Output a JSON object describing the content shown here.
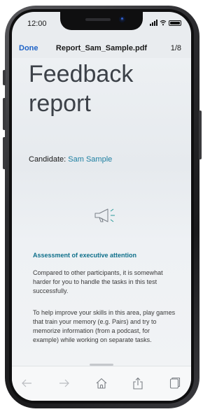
{
  "status_bar": {
    "time": "12:00"
  },
  "nav": {
    "done_label": "Done",
    "title": "Report_Sam_Sample.pdf",
    "page_indicator": "1/8"
  },
  "document": {
    "heading_line1": "Feedback",
    "heading_line2": "report",
    "candidate_label": "Candidate:",
    "candidate_name": "Sam Sample",
    "section_title": "Assessment of executive attention",
    "paragraph_1": "Compared to other participants, it is somewhat harder for you to handle the tasks in this test successfully.",
    "paragraph_2": "To help improve your skills in this area, play games that train your memory (e.g. Pairs) and try to memorize information (from a podcast, for example) while working on separate tasks."
  },
  "toolbar": {
    "icons": [
      "back-arrow-icon",
      "forward-arrow-icon",
      "home-icon",
      "share-icon",
      "tabs-icon"
    ]
  },
  "colors": {
    "accent": "#1e63c7",
    "section_title": "#0e6f8a",
    "candidate_name": "#1d7fa1"
  }
}
